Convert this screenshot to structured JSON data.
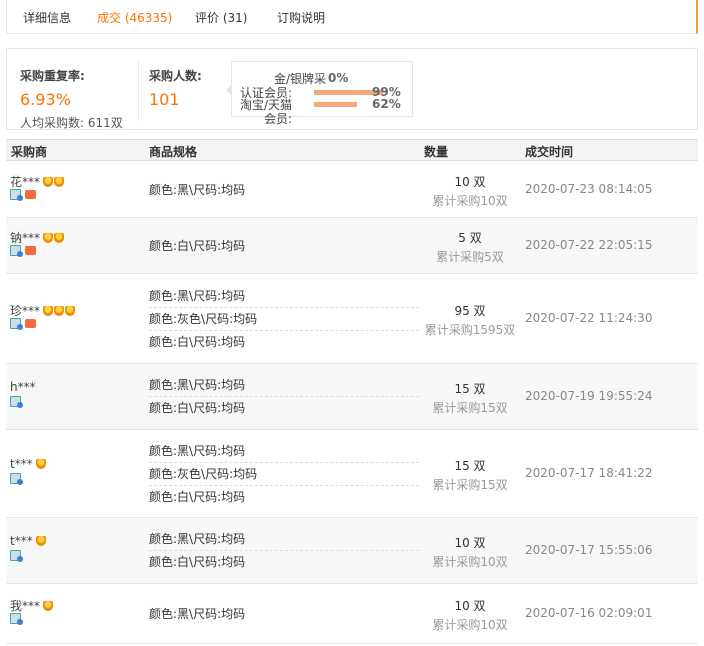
{
  "tabs": [
    {
      "label": "详细信息",
      "active": false
    },
    {
      "label": "成交 (46335)",
      "active": true
    },
    {
      "label": "评价 (31)",
      "active": false
    },
    {
      "label": "订购说明",
      "active": false
    }
  ],
  "summary": {
    "repeat_label": "采购重复率:",
    "repeat_value": "6.93%",
    "avg_label": "人均采购数: 611双",
    "buyers_label": "采购人数:",
    "buyers_value": "101",
    "distribution": [
      {
        "label": "金/银牌采",
        "pct": "0%",
        "fraction": 0.0
      },
      {
        "label": "认证会员:",
        "pct": "99%",
        "fraction": 0.99
      },
      {
        "label": "淘宝/天猫",
        "pct": "62%",
        "fraction": 0.62
      },
      {
        "label": "会员:",
        "pct": "",
        "fraction": 0
      }
    ]
  },
  "table": {
    "headers": [
      "采购商",
      "商品规格",
      "数量",
      "成交时间"
    ],
    "rows": [
      {
        "buyer": "花***",
        "medals": 2,
        "tag": true,
        "specs": [
          "颜色:黑\\尺码:均码"
        ],
        "qty": "10 双",
        "total": "累计采购10双",
        "time": "2020-07-23 08:14:05"
      },
      {
        "buyer": "钠***",
        "medals": 2,
        "tag": true,
        "specs": [
          "颜色:白\\尺码:均码"
        ],
        "qty": "5 双",
        "total": "累计采购5双",
        "time": "2020-07-22 22:05:15"
      },
      {
        "buyer": "珍***",
        "medals": 3,
        "tag": true,
        "specs": [
          "颜色:黑\\尺码:均码",
          "颜色:灰色\\尺码:均码",
          "颜色:白\\尺码:均码"
        ],
        "qty": "95 双",
        "total": "累计采购1595双",
        "time": "2020-07-22 11:24:30"
      },
      {
        "buyer": "h***",
        "medals": 0,
        "tag": false,
        "specs": [
          "颜色:黑\\尺码:均码",
          "颜色:白\\尺码:均码"
        ],
        "qty": "15 双",
        "total": "累计采购15双",
        "time": "2020-07-19 19:55:24"
      },
      {
        "buyer": "t***",
        "medals": 1,
        "tag": false,
        "specs": [
          "颜色:黑\\尺码:均码",
          "颜色:灰色\\尺码:均码",
          "颜色:白\\尺码:均码"
        ],
        "qty": "15 双",
        "total": "累计采购15双",
        "time": "2020-07-17 18:41:22"
      },
      {
        "buyer": "t***",
        "medals": 1,
        "tag": false,
        "specs": [
          "颜色:黑\\尺码:均码",
          "颜色:白\\尺码:均码"
        ],
        "qty": "10 双",
        "total": "累计采购10双",
        "time": "2020-07-17 15:55:06"
      },
      {
        "buyer": "我***",
        "medals": 1,
        "tag": false,
        "specs": [
          "颜色:黑\\尺码:均码"
        ],
        "qty": "10 双",
        "total": "累计采购10双",
        "time": "2020-07-16 02:09:01"
      }
    ]
  },
  "colors": {
    "accent": "#ff7300",
    "bar": "#f5a77e"
  }
}
